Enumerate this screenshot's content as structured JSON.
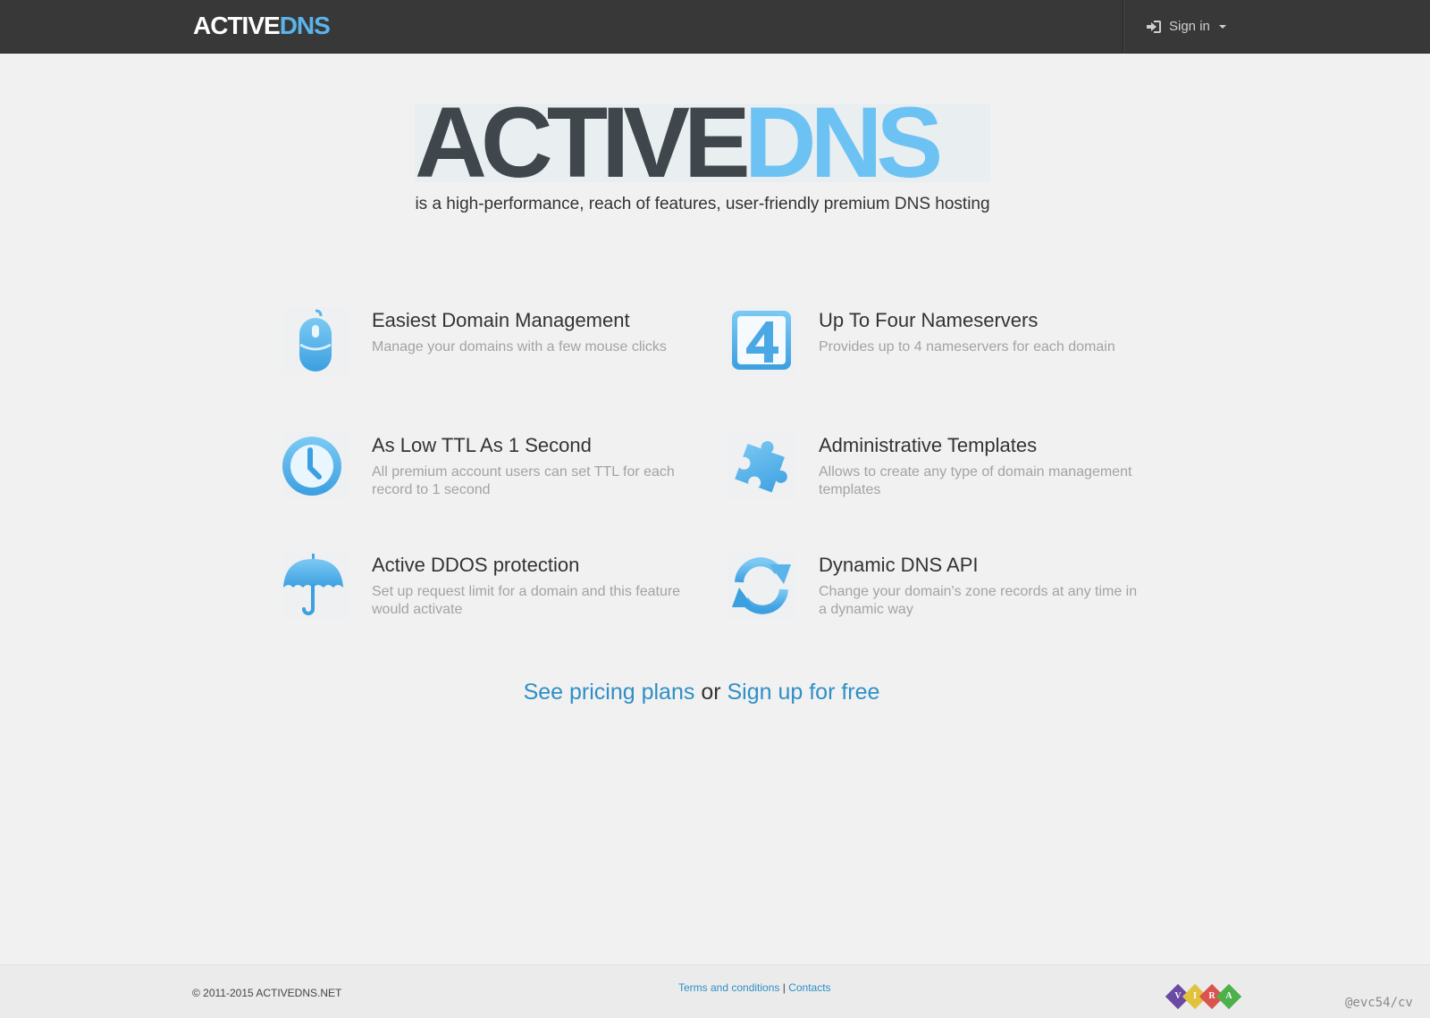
{
  "navbar": {
    "brand_part1": "ACTIVE",
    "brand_part2": "DNS",
    "signin_label": "Sign in"
  },
  "hero": {
    "logo_part1": "ACTIVE",
    "logo_part2": "DNS",
    "tagline": "is a high-performance, reach of features, user-friendly premium DNS hosting"
  },
  "features": [
    {
      "icon": "mouse-icon",
      "title": "Easiest Domain Management",
      "desc": "Manage your domains with a few mouse clicks"
    },
    {
      "icon": "number-four-icon",
      "title": "Up To Four Nameservers",
      "desc": "Provides up to 4 nameservers for each domain"
    },
    {
      "icon": "clock-icon",
      "title": "As Low TTL As 1 Second",
      "desc": "All premium account users can set TTL for each record to 1 second"
    },
    {
      "icon": "puzzle-icon",
      "title": "Administrative Templates",
      "desc": "Allows to create any type of domain management templates"
    },
    {
      "icon": "umbrella-icon",
      "title": "Active DDOS protection",
      "desc": "Set up request limit for a domain and this feature would activate"
    },
    {
      "icon": "refresh-icon",
      "title": "Dynamic DNS API",
      "desc": "Change your domain's zone records at any time in a dynamic way"
    }
  ],
  "cta": {
    "pricing_link": "See pricing plans",
    "or_text": "or",
    "signup_link": "Sign up for free"
  },
  "footer": {
    "copyright": "© 2011-2015 ACTIVEDNS.NET",
    "terms_link": "Terms and conditions",
    "separator": "|",
    "contacts_link": "Contacts",
    "vira_letters": [
      "V",
      "I",
      "R",
      "A"
    ],
    "watermark": "@evc54/cv"
  },
  "colors": {
    "brand_blue": "#5ab4ec",
    "icon_blue": "#4aa8e4",
    "link_blue": "#2e8fc6",
    "navbar_bg": "#383838"
  }
}
